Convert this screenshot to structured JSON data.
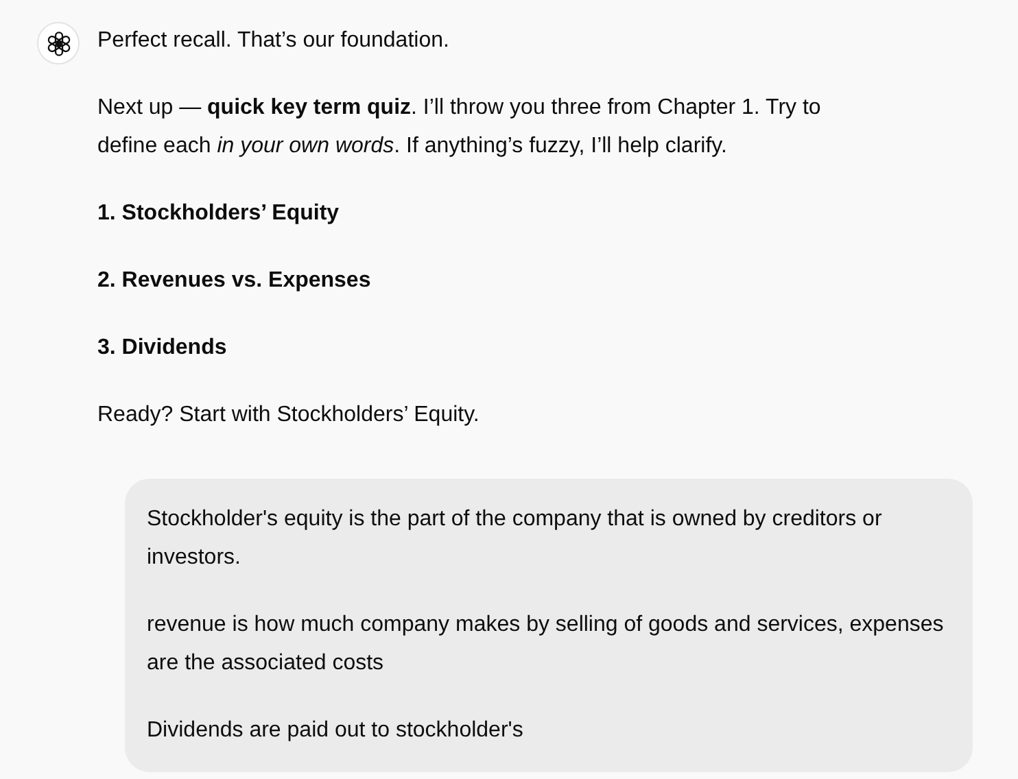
{
  "assistant_message": {
    "paragraphs": [
      {
        "kind": "text",
        "text": "Perfect recall. That’s our foundation."
      },
      {
        "kind": "text",
        "text": "Next up — **quick key term quiz**. I’ll throw you three from Chapter 1. Try to define each *in your own words*. If anything’s fuzzy, I’ll help clarify."
      },
      {
        "kind": "heading",
        "text": "1. Stockholders’ Equity"
      },
      {
        "kind": "heading",
        "text": "2. Revenues vs. Expenses"
      },
      {
        "kind": "heading",
        "text": "3. Dividends"
      },
      {
        "kind": "text",
        "text": "Ready? Start with Stockholders’ Equity."
      }
    ]
  },
  "user_message": {
    "paragraphs": [
      "Stockholder's equity is the part of the company that is owned by creditors or investors.",
      "revenue is how much company makes by selling of goods and services, expenses are the associated costs",
      "Dividends are paid out to stockholder's"
    ]
  }
}
